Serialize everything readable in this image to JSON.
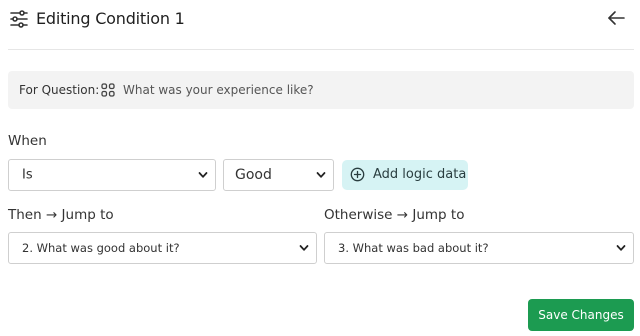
{
  "header": {
    "title": "Editing Condition 1",
    "left_icon": "sliders-icon",
    "right_icon": "arrow-left-icon"
  },
  "question": {
    "label": "For Question:",
    "icon": "grid-icon",
    "text": "What was your experience like?"
  },
  "when": {
    "label": "When",
    "operator_value": "Is",
    "answer_value": "Good",
    "add_logic_label": "Add logic data"
  },
  "then": {
    "label": "Then → Jump to",
    "value": "2. What was good about it?"
  },
  "otherwise": {
    "label": "Otherwise → Jump to",
    "value": "3. What was bad about it?"
  },
  "footer": {
    "save_label": "Save Changes"
  },
  "colors": {
    "accent_button": "#1c9b51",
    "add_logic_bg": "#d6f3f4",
    "question_bg": "#f3f3f3"
  }
}
